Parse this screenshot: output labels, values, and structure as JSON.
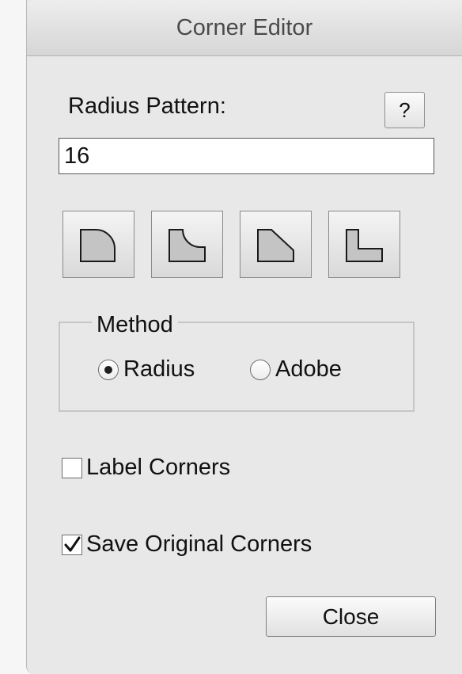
{
  "window": {
    "title": "Corner Editor"
  },
  "radius": {
    "label": "Radius Pattern:",
    "help_label": "?",
    "value": "16"
  },
  "corner_shapes": [
    {
      "icon": "rounded-corner-icon"
    },
    {
      "icon": "inverted-round-corner-icon"
    },
    {
      "icon": "chamfer-corner-icon"
    },
    {
      "icon": "notch-corner-icon"
    }
  ],
  "method": {
    "legend": "Method",
    "options": [
      {
        "label": "Radius",
        "selected": true
      },
      {
        "label": "Adobe",
        "selected": false
      }
    ]
  },
  "options": {
    "label_corners": {
      "label": "Label Corners",
      "checked": false
    },
    "save_original": {
      "label": "Save Original Corners",
      "checked": true
    }
  },
  "close_label": "Close"
}
